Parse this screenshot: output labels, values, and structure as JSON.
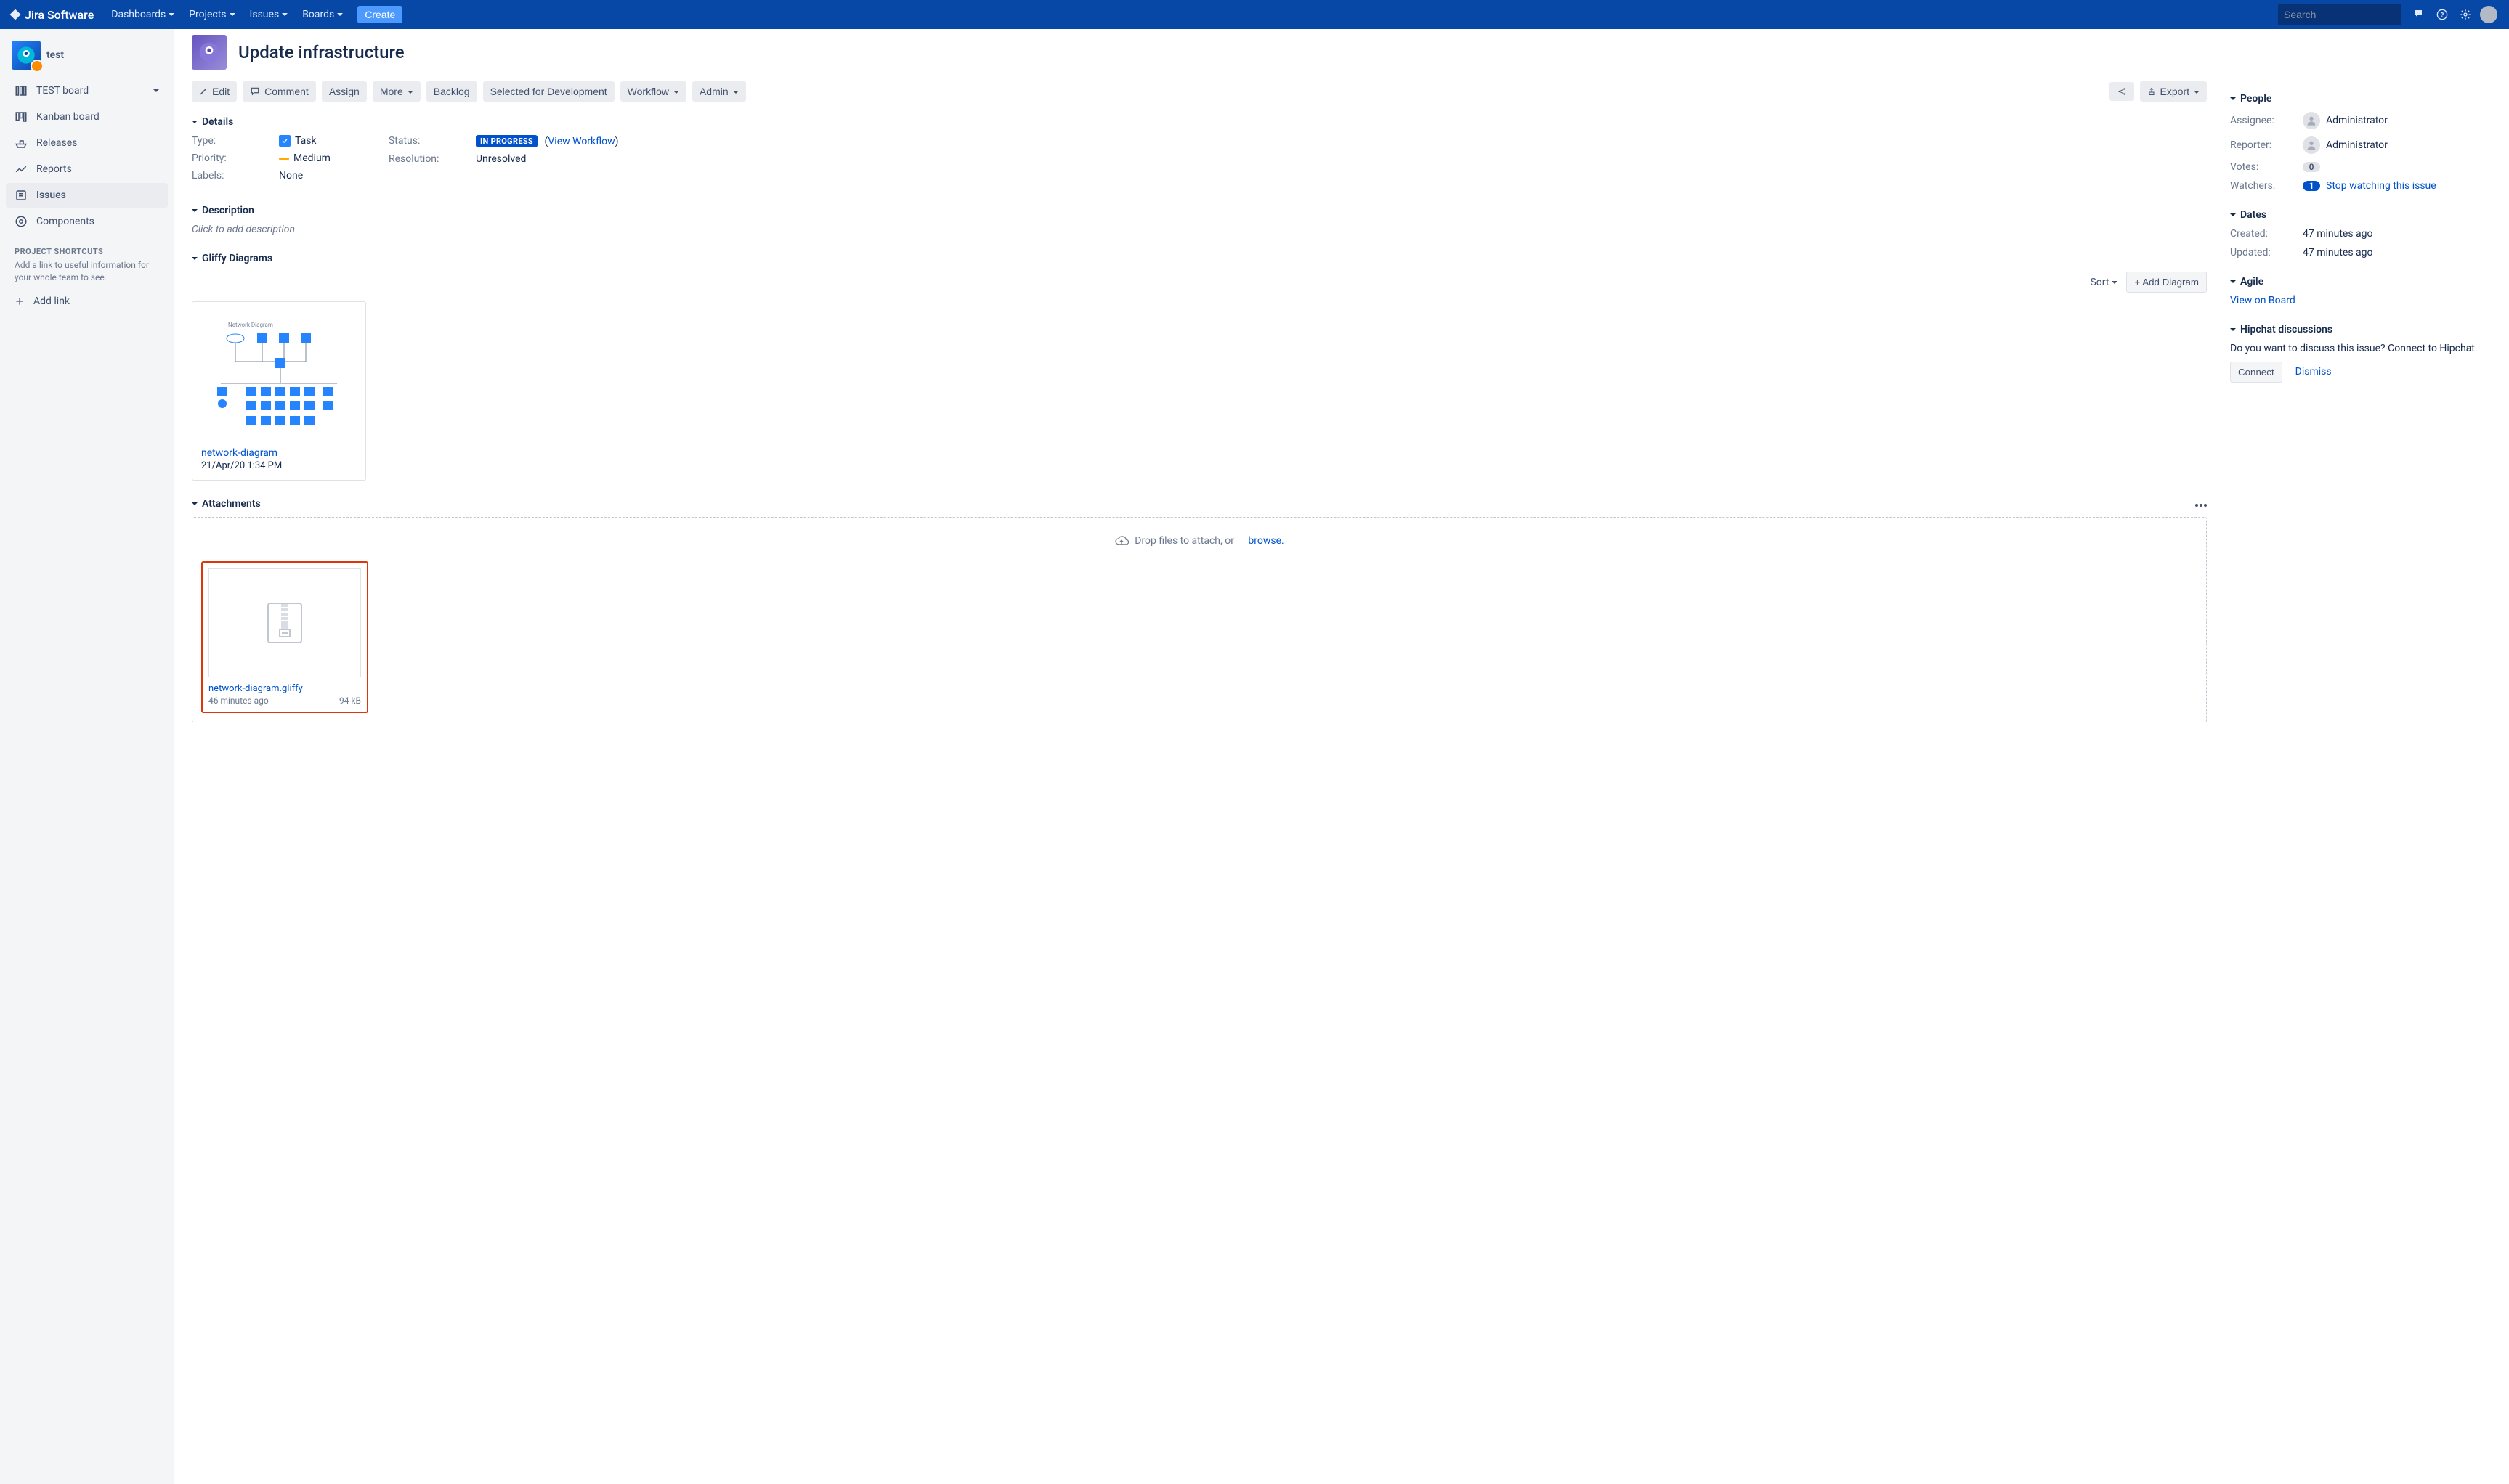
{
  "topnav": {
    "brand": "Jira Software",
    "items": [
      "Dashboards",
      "Projects",
      "Issues",
      "Boards"
    ],
    "create": "Create",
    "search_placeholder": "Search"
  },
  "sidebar": {
    "project_name": "test",
    "items": [
      {
        "label": "TEST board",
        "expandable": true
      },
      {
        "label": "Kanban board"
      },
      {
        "label": "Releases"
      },
      {
        "label": "Reports"
      },
      {
        "label": "Issues",
        "active": true
      },
      {
        "label": "Components"
      }
    ],
    "shortcuts_heading": "PROJECT SHORTCUTS",
    "shortcuts_desc": "Add a link to useful information for your whole team to see.",
    "add_link": "Add link"
  },
  "issue": {
    "title": "Update infrastructure"
  },
  "toolbar": {
    "edit": "Edit",
    "comment": "Comment",
    "assign": "Assign",
    "more": "More",
    "backlog": "Backlog",
    "selected": "Selected for Development",
    "workflow": "Workflow",
    "admin": "Admin",
    "export": "Export"
  },
  "details": {
    "heading": "Details",
    "type_label": "Type:",
    "type_value": "Task",
    "priority_label": "Priority:",
    "priority_value": "Medium",
    "labels_label": "Labels:",
    "labels_value": "None",
    "status_label": "Status:",
    "status_value": "IN PROGRESS",
    "view_workflow": "View Workflow",
    "resolution_label": "Resolution:",
    "resolution_value": "Unresolved"
  },
  "description": {
    "heading": "Description",
    "placeholder": "Click to add description"
  },
  "gliffy": {
    "heading": "Gliffy Diagrams",
    "sort": "Sort",
    "add": "+ Add Diagram",
    "diagram_title": "Network Diagram",
    "diagram_name": "network-diagram",
    "diagram_date": "21/Apr/20 1:34 PM"
  },
  "attachments": {
    "heading": "Attachments",
    "drop_hint": "Drop files to attach, or",
    "browse": "browse",
    "file_name": "network-diagram.gliffy",
    "file_ago": "46 minutes ago",
    "file_size": "94 kB"
  },
  "people": {
    "heading": "People",
    "assignee_label": "Assignee:",
    "assignee_value": "Administrator",
    "reporter_label": "Reporter:",
    "reporter_value": "Administrator",
    "votes_label": "Votes:",
    "votes_value": "0",
    "watchers_label": "Watchers:",
    "watchers_count": "1",
    "watchers_action": "Stop watching this issue"
  },
  "dates": {
    "heading": "Dates",
    "created_label": "Created:",
    "created_value": "47 minutes ago",
    "updated_label": "Updated:",
    "updated_value": "47 minutes ago"
  },
  "agile": {
    "heading": "Agile",
    "view": "View on Board"
  },
  "hipchat": {
    "heading": "Hipchat discussions",
    "prompt": "Do you want to discuss this issue? Connect to Hipchat.",
    "connect": "Connect",
    "dismiss": "Dismiss"
  }
}
